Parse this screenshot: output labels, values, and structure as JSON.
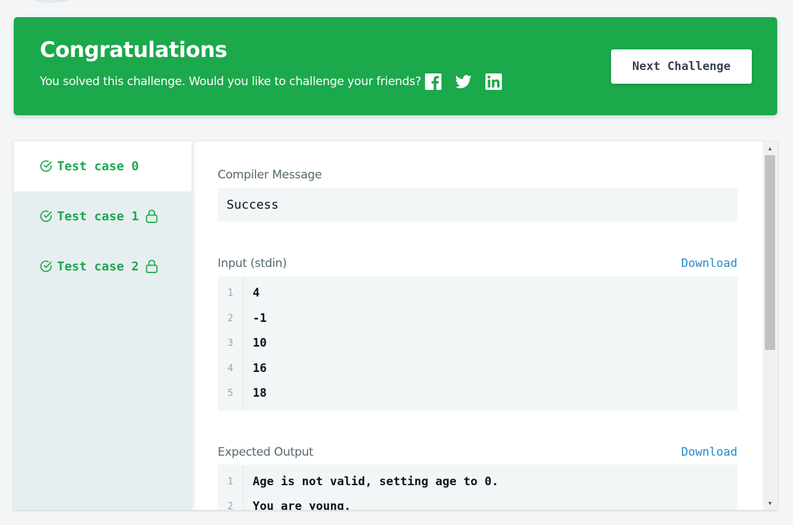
{
  "banner": {
    "title": "Congratulations",
    "message": "You solved this challenge. Would you like to challenge your friends?",
    "share_icons": [
      "facebook-icon",
      "twitter-icon",
      "linkedin-icon"
    ],
    "next_button_label": "Next Challenge",
    "background_color": "#1ba94c"
  },
  "sidebar": {
    "tabs": [
      {
        "label": "Test case 0",
        "active": true,
        "locked": false
      },
      {
        "label": "Test case 1",
        "active": false,
        "locked": true
      },
      {
        "label": "Test case 2",
        "active": false,
        "locked": true
      }
    ],
    "accent_color": "#1ba94c"
  },
  "result": {
    "compiler_message_label": "Compiler Message",
    "compiler_message": "Success",
    "input_label": "Input (stdin)",
    "input_download": "Download",
    "input_lines": [
      {
        "num": "1",
        "text": "4"
      },
      {
        "num": "2",
        "text": "-1"
      },
      {
        "num": "3",
        "text": "10"
      },
      {
        "num": "4",
        "text": "16"
      },
      {
        "num": "5",
        "text": "18"
      }
    ],
    "expected_label": "Expected Output",
    "expected_download": "Download",
    "expected_lines": [
      {
        "num": "1",
        "text": "Age is not valid, setting age to 0."
      },
      {
        "num": "2",
        "text": "You are young."
      }
    ],
    "link_color": "#1f8acb"
  }
}
